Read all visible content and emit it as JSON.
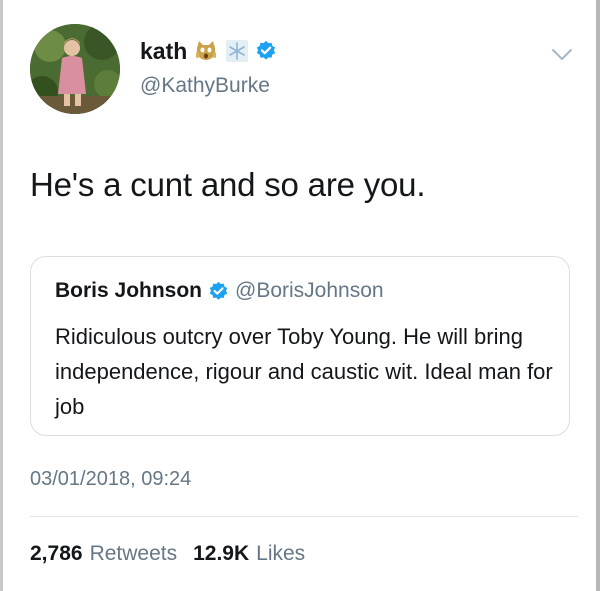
{
  "tweet": {
    "display_name": "kath",
    "handle": "@KathyBurke",
    "text": "He's a cunt and so are you.",
    "timestamp": "03/01/2018, 09:24",
    "retweets_count": "2,786",
    "retweets_label": "Retweets",
    "likes_count": "12.9K",
    "likes_label": "Likes",
    "name_emojis": [
      "scream-cat-icon",
      "snowflake-icon"
    ],
    "verified": true
  },
  "quoted_tweet": {
    "display_name": "Boris Johnson",
    "handle": "@BorisJohnson",
    "text": "Ridiculous outcry over Toby Young. He will bring independence, rigour and caustic wit. Ideal man for job",
    "verified": true
  },
  "colors": {
    "text": "#14171a",
    "secondary": "#657786",
    "verified_blue": "#1da1f2",
    "border": "#d8dee3"
  }
}
